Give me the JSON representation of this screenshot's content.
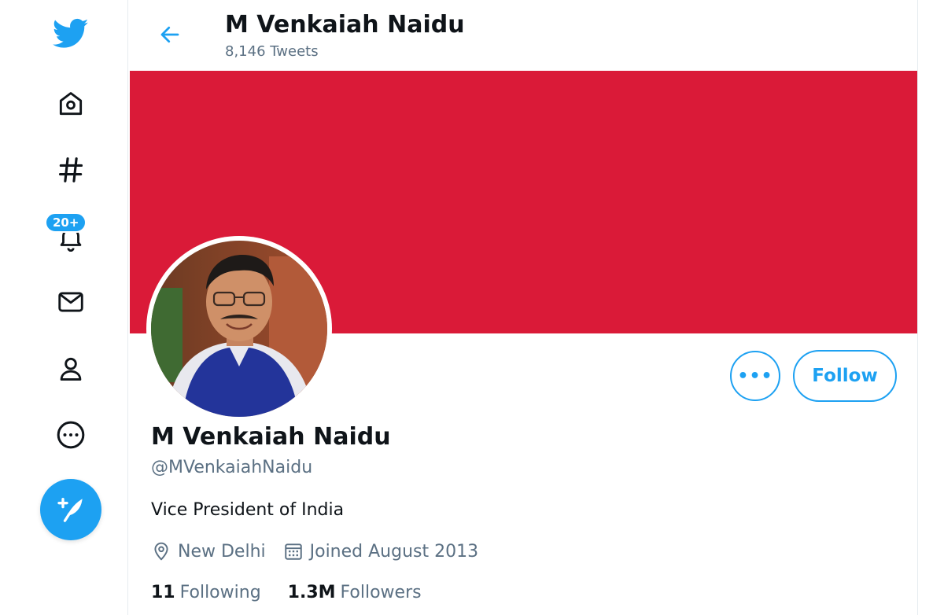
{
  "nav": {
    "icons": [
      "twitter-bird-icon",
      "home-icon",
      "explore-hashtag-icon",
      "notifications-bell-icon",
      "messages-envelope-icon",
      "profile-person-icon",
      "more-circle-icon"
    ],
    "notifications_badge": "20+",
    "tweet_button_icon": "compose-feather-icon"
  },
  "header": {
    "name": "M Venkaiah Naidu",
    "tweet_count": "8,146 Tweets"
  },
  "profile": {
    "banner_color": "#da1a38",
    "name": "M Venkaiah Naidu",
    "handle": "@MVenkaiahNaidu",
    "bio": "Vice President of India",
    "location": "New Delhi",
    "joined": "Joined August 2013",
    "following_count": "11",
    "following_label": "Following",
    "followers_count": "1.3M",
    "followers_label": "Followers"
  },
  "actions": {
    "more_label": "•••",
    "follow_label": "Follow"
  },
  "colors": {
    "accent": "#1da1f2",
    "secondary_text": "#5b7083"
  }
}
